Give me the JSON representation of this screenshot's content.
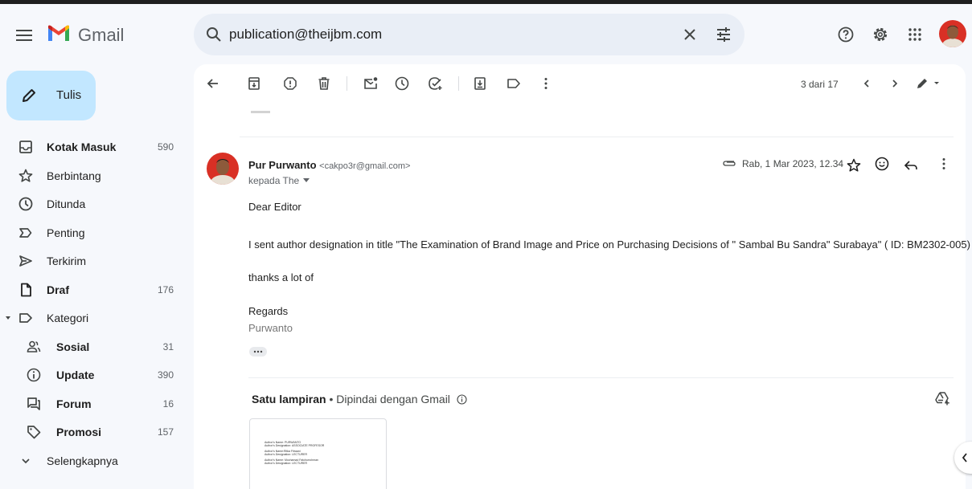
{
  "app": {
    "brand": "Gmail"
  },
  "search": {
    "value": "publication@theijbm.com"
  },
  "compose": {
    "label": "Tulis"
  },
  "sidebar": {
    "items": [
      {
        "label": "Kotak Masuk",
        "count": "590",
        "icon": "inbox-icon"
      },
      {
        "label": "Berbintang",
        "count": "",
        "icon": "star-icon"
      },
      {
        "label": "Ditunda",
        "count": "",
        "icon": "clock-icon"
      },
      {
        "label": "Penting",
        "count": "",
        "icon": "important-icon"
      },
      {
        "label": "Terkirim",
        "count": "",
        "icon": "send-icon"
      },
      {
        "label": "Draf",
        "count": "176",
        "icon": "draft-icon"
      },
      {
        "label": "Kategori",
        "count": "",
        "icon": "label-icon"
      },
      {
        "label": "Sosial",
        "count": "31",
        "icon": "people-icon"
      },
      {
        "label": "Update",
        "count": "390",
        "icon": "info-icon"
      },
      {
        "label": "Forum",
        "count": "16",
        "icon": "forum-icon"
      },
      {
        "label": "Promosi",
        "count": "157",
        "icon": "tag-icon"
      },
      {
        "label": "Selengkapnya",
        "count": "",
        "icon": "chevron-down-icon"
      }
    ]
  },
  "toolbar": {
    "pager": "3 dari 17"
  },
  "message": {
    "sender_name": "Pur Purwanto",
    "sender_email": "<cakpo3r@gmail.com>",
    "to": "kepada The",
    "date": "Rab, 1 Mar 2023, 12.34",
    "body": [
      "Dear Editor",
      "I sent author designation in title  \"The Examination of Brand Image and Price on Purchasing Decisions of \" Sambal Bu Sandra\" Surabaya\" ( ID: BM2302-005)",
      "thanks a lot of",
      "Regards"
    ],
    "signature": "Purwanto"
  },
  "attachment": {
    "title": "Satu lampiran",
    "separator": " • ",
    "scanned": "Dipindai dengan Gmail",
    "preview_lines": [
      "Author's Name: PURWANTO",
      "Author's Designation: ASSOCIATE PROFESOR",
      "Author's Name:Ritka Fitraani",
      "Author's Designation: LECTURER",
      "Author's Name: Mochamad Fatchurrohman",
      "Author's Designation: LECTURER"
    ]
  }
}
